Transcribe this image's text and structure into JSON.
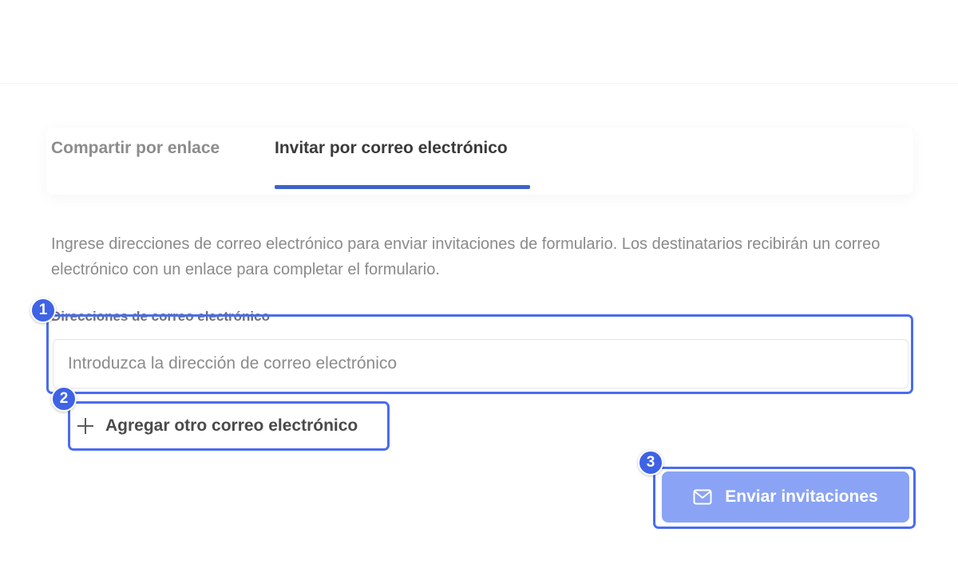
{
  "tabs": [
    {
      "label": "Compartir por enlace",
      "active": false
    },
    {
      "label": "Invitar por correo electrónico",
      "active": true
    }
  ],
  "description": "Ingrese direcciones de correo electrónico para enviar invitaciones de formulario. Los destinatarios recibirán un correo electrónico con un enlace para completar el formulario.",
  "email_field": {
    "label": "Direcciones de correo electrónico",
    "value": "",
    "placeholder": "Introduzca la dirección de correo electrónico"
  },
  "add_email": {
    "label": "Agregar otro correo electrónico",
    "icon": "plus-icon"
  },
  "send_button": {
    "label": "Enviar invitaciones",
    "icon": "mail-icon"
  },
  "annotations": [
    {
      "number": "1"
    },
    {
      "number": "2"
    },
    {
      "number": "3"
    }
  ],
  "colors": {
    "accent": "#3e64c8",
    "send_button": "#8aa3f4",
    "annotation": "#4a6cf0"
  }
}
